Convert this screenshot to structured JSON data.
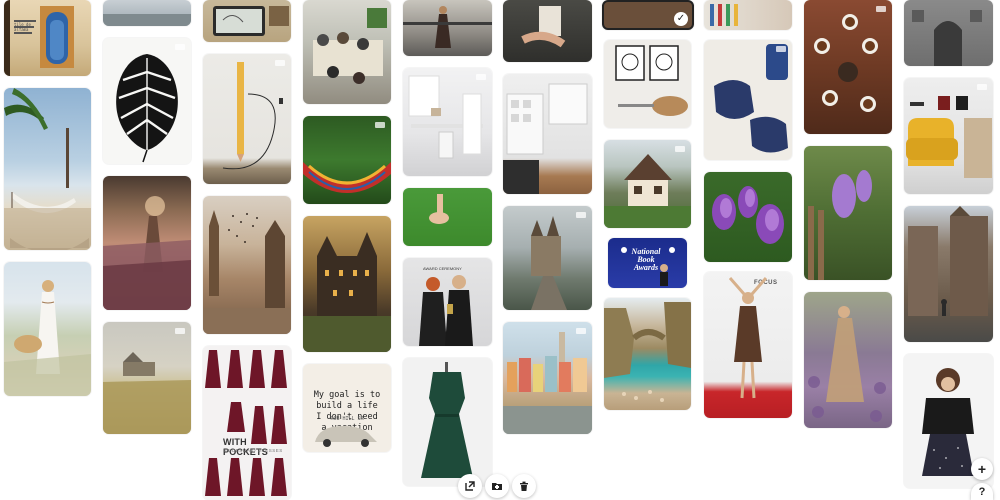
{
  "pins": {
    "quote": {
      "text": "My goal is to build a life I don't need a vacation from.",
      "credit": "ROB HILL SR"
    },
    "pockets": {
      "title": "WITH POCKETS",
      "subtitle": "BRIDESMAID DRESSES"
    },
    "book_award": {
      "text": "National Book Awards"
    },
    "red_carpet": {
      "backdrop": "FOCUS"
    },
    "award_event": {
      "banner": "AWARD CEREMONY"
    },
    "tile_note": {
      "text": "tile de alfama"
    }
  },
  "toolbar": {
    "move_label": "move",
    "folder_label": "folder",
    "delete_label": "delete"
  },
  "fab": {
    "add_label": "+",
    "help_label": "?"
  },
  "colors": {
    "background": "#ffffff",
    "button": "#ffffff",
    "icon": "#222222"
  }
}
